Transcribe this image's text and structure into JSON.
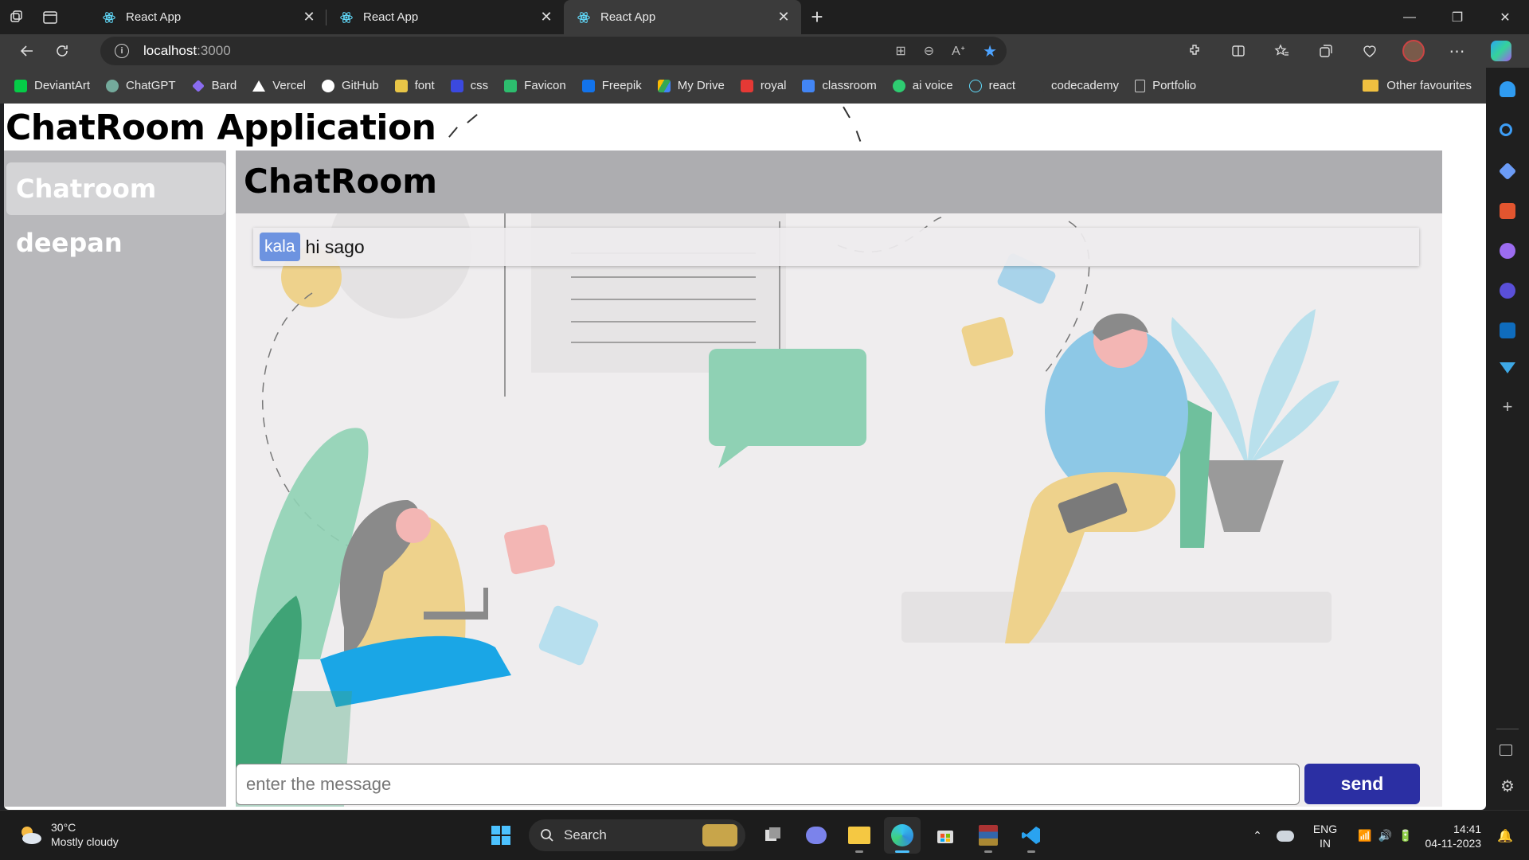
{
  "browser": {
    "tabs": [
      {
        "title": "React App",
        "active": false
      },
      {
        "title": "React App",
        "active": false
      },
      {
        "title": "React App",
        "active": true
      }
    ],
    "address": {
      "host": "localhost",
      "port": ":3000"
    },
    "bookmarks": [
      {
        "label": "DeviantArt",
        "color": "#05cc47"
      },
      {
        "label": "ChatGPT",
        "color": "#74aa9c"
      },
      {
        "label": "Bard",
        "color": "#8a6cf0"
      },
      {
        "label": "Vercel",
        "color": "#ffffff"
      },
      {
        "label": "GitHub",
        "color": "#ffffff"
      },
      {
        "label": "font",
        "color": "#e8c547"
      },
      {
        "label": "css",
        "color": "#3b49df"
      },
      {
        "label": "Favicon",
        "color": "#2dbd6e"
      },
      {
        "label": "Freepik",
        "color": "#1273eb"
      },
      {
        "label": "My Drive",
        "color": "#34a853"
      },
      {
        "label": "royal",
        "color": "#e53935"
      },
      {
        "label": "classroom",
        "color": "#4285f4"
      },
      {
        "label": "ai voice",
        "color": "#2ecc71"
      },
      {
        "label": "react",
        "color": "#61dafb"
      },
      {
        "label": "codecademy",
        "color": "#3b3b3b"
      },
      {
        "label": "Portfolio",
        "color": "#cccccc"
      }
    ],
    "other_favourites": "Other favourites"
  },
  "app": {
    "title": "ChatRoom Application",
    "rooms": [
      {
        "name": "Chatroom",
        "active": true
      },
      {
        "name": "deepan",
        "active": false
      }
    ],
    "chat_header": "ChatRoom",
    "messages": [
      {
        "sender": "kala",
        "text": "hi sago"
      }
    ],
    "composer": {
      "placeholder": "enter the message",
      "send_label": "send"
    }
  },
  "taskbar": {
    "weather": {
      "temp": "30°C",
      "condition": "Mostly cloudy"
    },
    "search_label": "Search",
    "lang": {
      "line1": "ENG",
      "line2": "IN"
    },
    "clock": {
      "time": "14:41",
      "date": "04-11-2023"
    }
  },
  "colors": {
    "accent_send": "#2b2fa3",
    "sender_badge": "#6d93e0",
    "sidebar": "#b8b8bb",
    "header": "#adadb0"
  }
}
